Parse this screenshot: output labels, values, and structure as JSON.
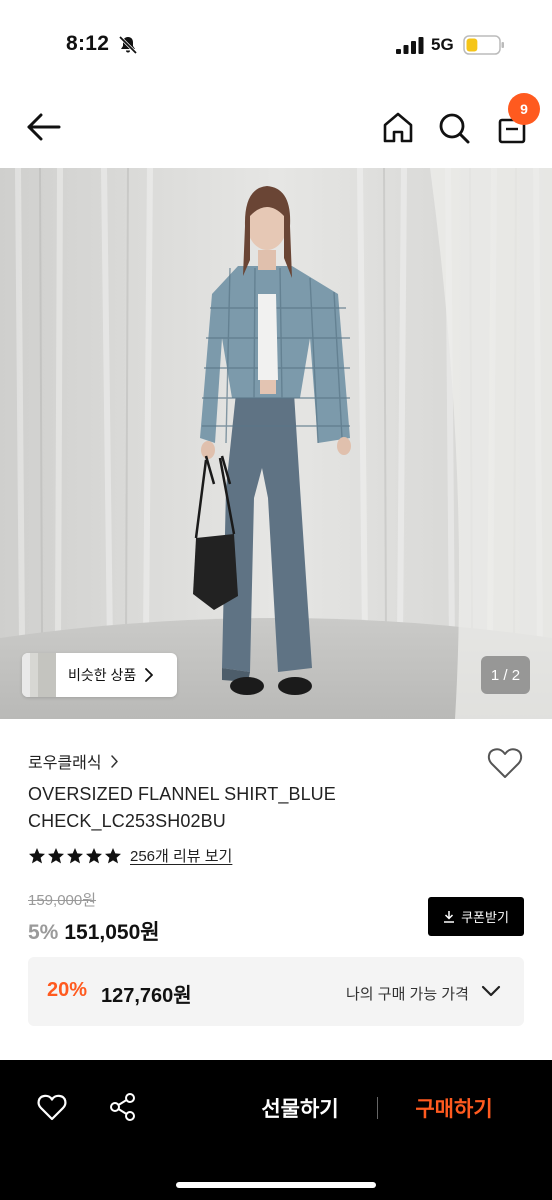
{
  "status_bar": {
    "time": "8:12",
    "network": "5G",
    "icons": [
      "bell-slash-icon",
      "signal-icon",
      "battery-icon"
    ],
    "battery_level": 0.35
  },
  "nav": {
    "icons": [
      "back-arrow-icon",
      "home-icon",
      "search-icon",
      "cart-icon"
    ],
    "cart_count": "9"
  },
  "gallery": {
    "similar_label": "비슷한 상품",
    "page_indicator": "1 / 2"
  },
  "product": {
    "brand": "로우클래식",
    "name_line1": "OVERSIZED FLANNEL SHIRT_BLUE",
    "name_line2": "CHECK_LC253SH02BU",
    "rating_stars": 5,
    "review_link": "256개 리뷰 보기",
    "original_price": "159,000원",
    "discount_rate": "5%",
    "sale_price": "151,050원",
    "coupon_label": "쿠폰받기"
  },
  "my_price": {
    "rate": "20%",
    "price": "127,760원",
    "label": "나의 구매 가능 가격"
  },
  "bottom_bar": {
    "gift_label": "선물하기",
    "buy_label": "구매하기"
  },
  "colors": {
    "accent": "#ff5a1f",
    "bar_background": "#000000",
    "muted": "#9a9a9a"
  }
}
